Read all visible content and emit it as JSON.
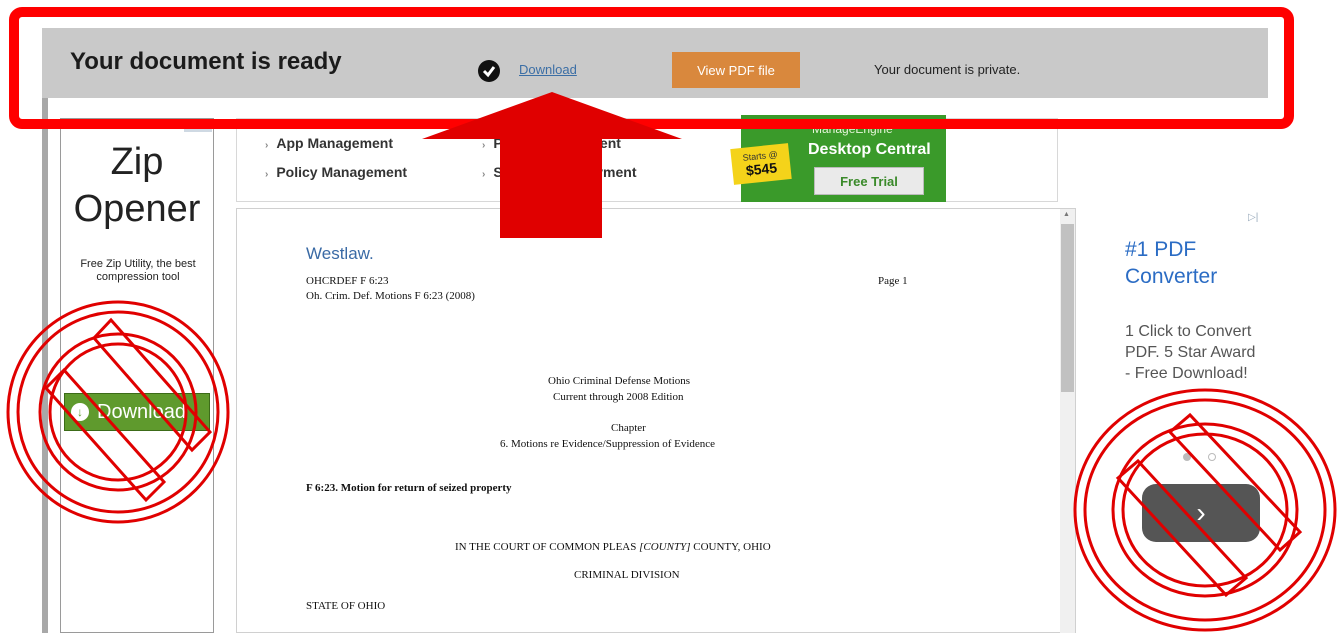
{
  "header": {
    "title": "Your document is ready",
    "download_label": "Download",
    "view_pdf_label": "View PDF file",
    "private_text": "Your document is private."
  },
  "left_ad": {
    "title_line1": "Zip",
    "title_line2": "Opener",
    "description": "Free Zip Utility, the best compression tool",
    "button_label": "Download"
  },
  "top_links": {
    "items": [
      "App Management",
      "Policy Management",
      "Patch Management",
      "Software Deployment"
    ]
  },
  "desktop_central_ad": {
    "brand": "ManageEngine",
    "title": "Desktop Central",
    "starts_label": "Starts @",
    "price": "$545",
    "trial_label": "Free Trial"
  },
  "document": {
    "logo": "Westlaw.",
    "citation_line1": "OHCRDEF F 6:23",
    "citation_line2": "Oh. Crim. Def. Motions F 6:23 (2008)",
    "page_label": "Page 1",
    "book_title": "Ohio Criminal Defense Motions",
    "edition": "Current through 2008 Edition",
    "chapter_label": "Chapter",
    "chapter_title": "6. Motions re Evidence/Suppression of Evidence",
    "section_title": "F 6:23. Motion for return of seized property",
    "court_prefix": "IN THE COURT OF COMMON PLEAS ",
    "court_county": "[COUNTY]",
    "court_suffix": " COUNTY, OHIO",
    "division": "CRIMINAL DIVISION",
    "party": "STATE OF OHIO"
  },
  "right_ad": {
    "title_line1": "#1 PDF",
    "title_line2": "Converter",
    "description": "1 Click to Convert PDF. 5 Star Award - Free Download!",
    "next_label": "›"
  },
  "annotation_colors": {
    "highlight": "#ff0000",
    "arrow": "#e00000"
  }
}
